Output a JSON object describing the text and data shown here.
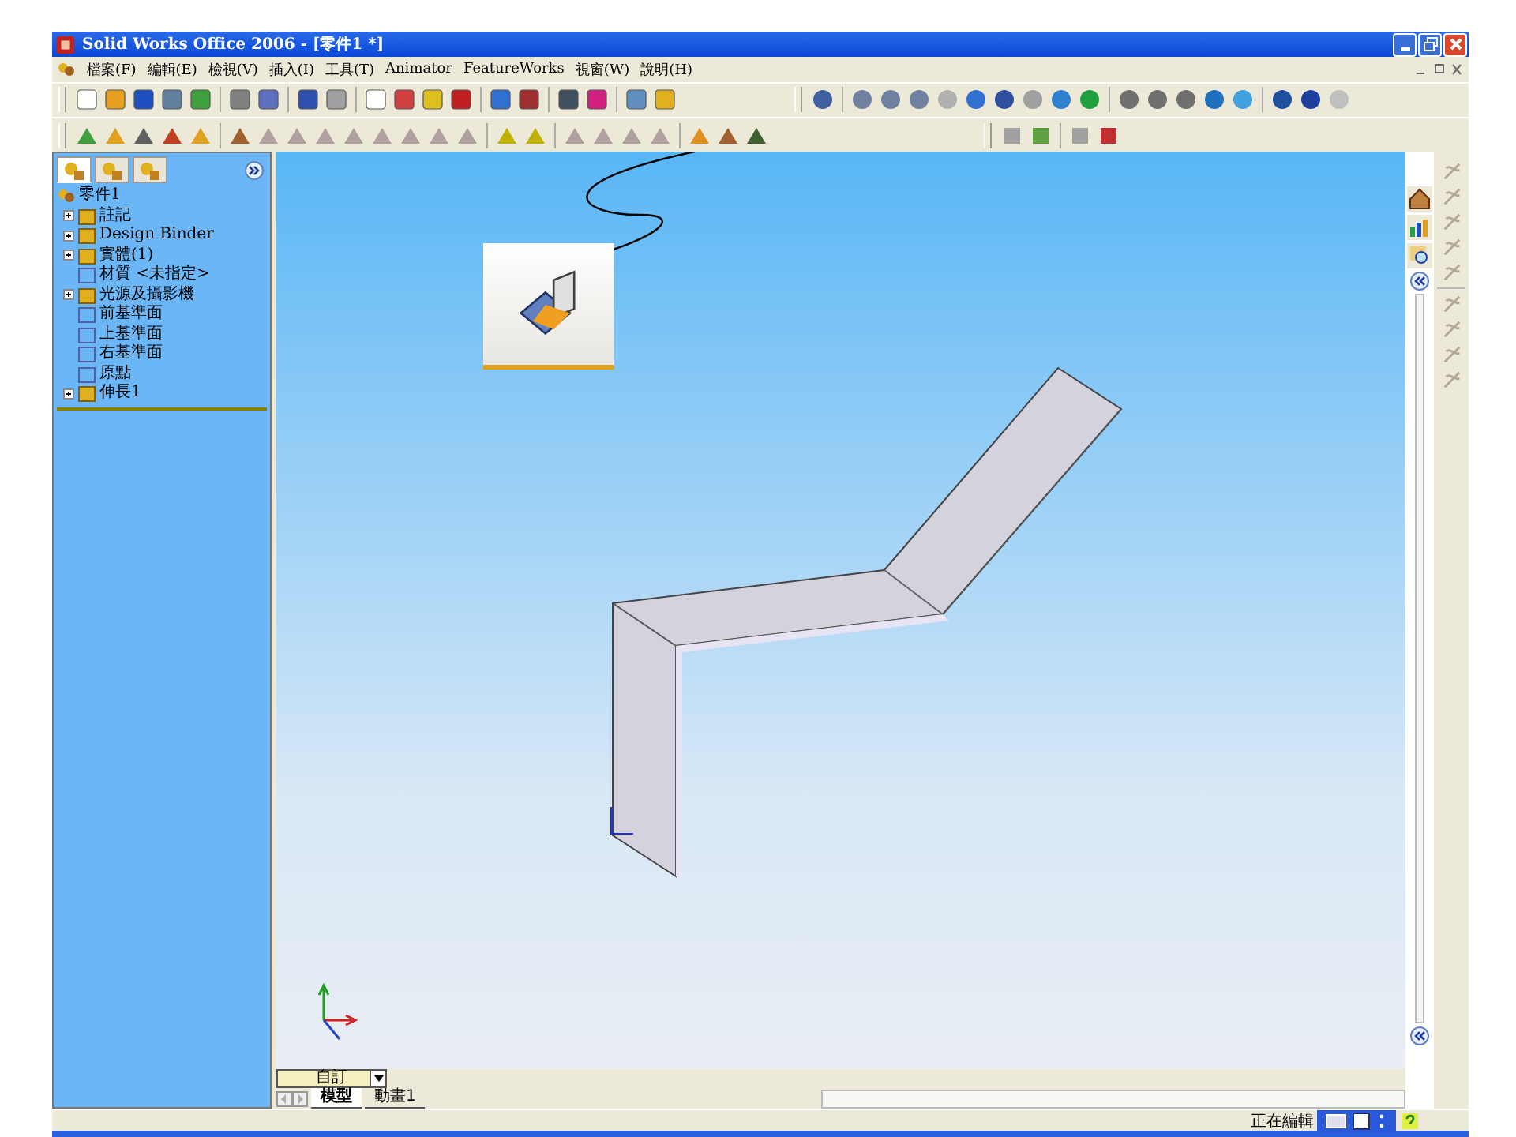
{
  "window": {
    "title": "Solid Works Office 2006 - [零件1 *]"
  },
  "menu": [
    "檔案(F)",
    "編輯(E)",
    "檢視(V)",
    "插入(I)",
    "工具(T)",
    "Animator",
    "FeatureWorks",
    "視窗(W)",
    "說明(H)"
  ],
  "feature_tree": {
    "tabs": [
      {
        "selected": true
      },
      {
        "selected": false
      },
      {
        "selected": false
      }
    ],
    "root": "零件1",
    "items": [
      {
        "label": "註記",
        "kind": "node"
      },
      {
        "label": "Design Binder",
        "kind": "node"
      },
      {
        "label": "實體(1)",
        "kind": "node"
      },
      {
        "label": "材質 <未指定>",
        "kind": "leaf"
      },
      {
        "label": "光源及攝影機",
        "kind": "node"
      },
      {
        "label": "前基準面",
        "kind": "leaf"
      },
      {
        "label": "上基準面",
        "kind": "leaf"
      },
      {
        "label": "右基準面",
        "kind": "leaf"
      },
      {
        "label": "原點",
        "kind": "leaf"
      },
      {
        "label": "伸長1",
        "kind": "node"
      }
    ]
  },
  "configuration": "自訂",
  "sheet_tabs": [
    {
      "label": "模型",
      "selected": true
    },
    {
      "label": "動畫1",
      "selected": false
    }
  ],
  "status_bar": {
    "text": "正在編輯"
  }
}
